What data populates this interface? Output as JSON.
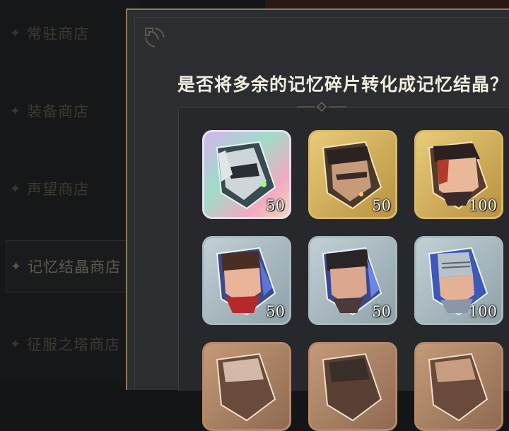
{
  "sidebar": {
    "items": [
      {
        "label": "常驻商店",
        "active": false
      },
      {
        "label": "装备商店",
        "active": false
      },
      {
        "label": "声望商店",
        "active": false
      },
      {
        "label": "记忆结晶商店",
        "active": true
      },
      {
        "label": "征服之塔商店",
        "active": false
      }
    ]
  },
  "dialog": {
    "title": "是否将多余的记忆碎片转化成记忆结晶？",
    "shards": [
      {
        "rarity": "rainbow",
        "count": "50",
        "portrait": "white-haired-masked-character-icon"
      },
      {
        "rarity": "gold",
        "count": "50",
        "portrait": "dark-hat-character-icon"
      },
      {
        "rarity": "gold",
        "count": "100",
        "portrait": "red-hair-cap-character-icon"
      },
      {
        "rarity": "silver",
        "count": "50",
        "portrait": "brown-hair-red-collar-character-icon"
      },
      {
        "rarity": "silver",
        "count": "50",
        "portrait": "dark-hair-character-icon"
      },
      {
        "rarity": "silver",
        "count": "100",
        "portrait": "armored-knight-character-icon"
      },
      {
        "rarity": "bronze",
        "count": "",
        "portrait": "bronze-character-icon"
      },
      {
        "rarity": "bronze",
        "count": "",
        "portrait": "bronze-character-icon"
      },
      {
        "rarity": "bronze",
        "count": "",
        "portrait": "bronze-character-icon"
      }
    ]
  },
  "colors": {
    "accent_gold": "#8c7d5c",
    "title_text": "#f1ece0",
    "rarity_rainbow": "#e6dff0",
    "rarity_gold": "#d9b968",
    "rarity_silver": "#a9b8bf",
    "rarity_bronze": "#b58a6a"
  }
}
